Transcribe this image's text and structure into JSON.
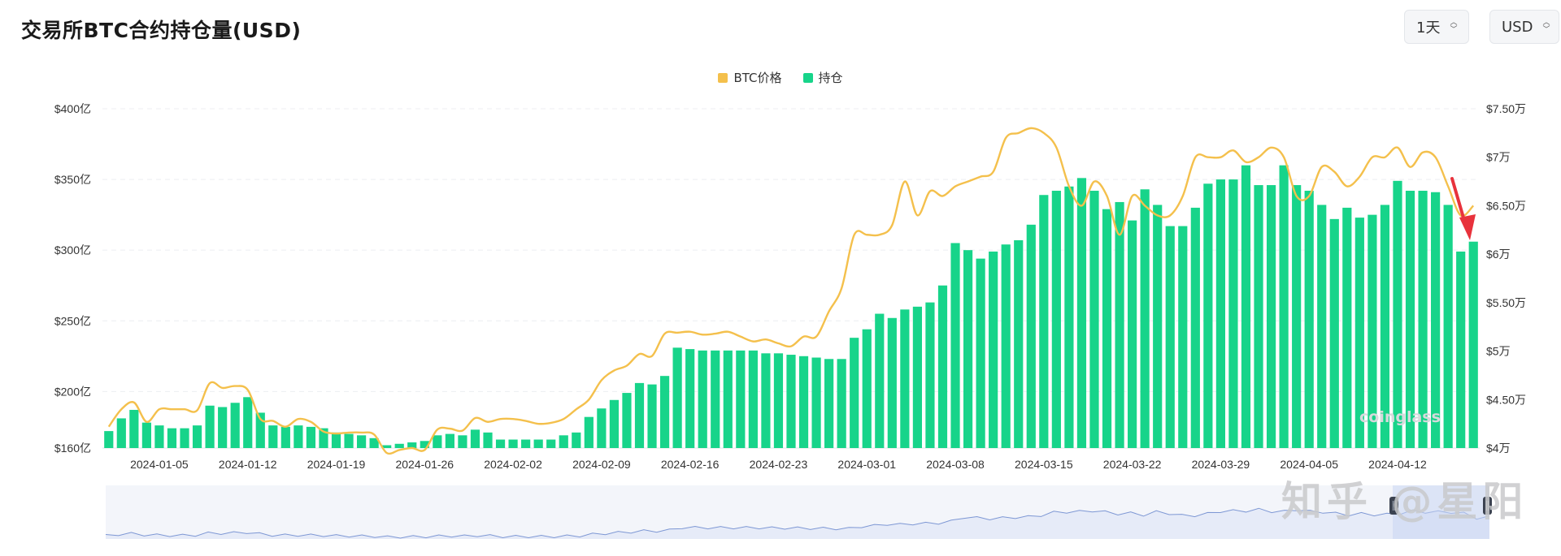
{
  "header": {
    "title": "交易所BTC合约持仓量(USD)",
    "range_select": "1天",
    "currency_select": "USD"
  },
  "legend": {
    "price_label": "BTC价格",
    "oi_label": "持仓",
    "price_color": "#f4c04c",
    "oi_color": "#17d48a"
  },
  "watermark": {
    "brand": "coinglass",
    "zhihu": "知乎 @星阳"
  },
  "chart_data": {
    "type": "bar",
    "title": "交易所BTC合约持仓量(USD)",
    "x_tick_labels": [
      "2024-01-05",
      "2024-01-12",
      "2024-01-19",
      "2024-01-26",
      "2024-02-02",
      "2024-02-09",
      "2024-02-16",
      "2024-02-23",
      "2024-03-01",
      "2024-03-08",
      "2024-03-15",
      "2024-03-22",
      "2024-03-29",
      "2024-04-05",
      "2024-04-12"
    ],
    "y_left": {
      "ticks": [
        "$400亿",
        "$350亿",
        "$300亿",
        "$250亿",
        "$200亿",
        "$160亿"
      ],
      "tick_values": [
        400,
        350,
        300,
        250,
        200,
        160
      ],
      "range": [
        160,
        400
      ]
    },
    "y_right": {
      "ticks": [
        "$7.50万",
        "$7万",
        "$6.50万",
        "$6万",
        "$5.50万",
        "$5万",
        "$4.50万",
        "$4万"
      ],
      "tick_values": [
        7.5,
        7,
        6.5,
        6,
        5.5,
        5,
        4.5,
        4
      ],
      "range": [
        4,
        7.5
      ]
    },
    "grid": true,
    "legend_position": "top-center",
    "start_date": "2024-01-01",
    "series": [
      {
        "name": "持仓",
        "kind": "bar",
        "axis": "left",
        "unit": "亿 USD",
        "values": [
          172,
          181,
          187,
          178,
          176,
          174,
          174,
          176,
          190,
          189,
          192,
          196,
          185,
          176,
          175,
          176,
          175,
          174,
          171,
          170,
          169,
          167,
          162,
          163,
          164,
          165,
          169,
          170,
          169,
          173,
          171,
          166,
          166,
          166,
          166,
          166,
          169,
          171,
          182,
          188,
          194,
          199,
          206,
          205,
          211,
          231,
          230,
          229,
          229,
          229,
          229,
          229,
          227,
          227,
          226,
          225,
          224,
          223,
          223,
          238,
          244,
          255,
          252,
          258,
          260,
          263,
          275,
          305,
          300,
          294,
          299,
          304,
          307,
          318,
          339,
          342,
          345,
          351,
          342,
          329,
          334,
          321,
          343,
          332,
          317,
          317,
          330,
          347,
          350,
          350,
          360,
          346,
          346,
          360,
          346,
          342,
          332,
          322,
          330,
          323,
          325,
          332,
          349,
          342,
          342,
          341,
          332,
          299,
          306
        ]
      },
      {
        "name": "BTC价格",
        "kind": "line",
        "axis": "right",
        "unit": "万 USD",
        "values": [
          4.22,
          4.4,
          4.47,
          4.27,
          4.4,
          4.4,
          4.4,
          4.39,
          4.67,
          4.62,
          4.64,
          4.6,
          4.3,
          4.28,
          4.22,
          4.3,
          4.27,
          4.17,
          4.15,
          4.16,
          4.16,
          4.14,
          3.95,
          3.98,
          4.0,
          3.98,
          4.19,
          4.2,
          4.18,
          4.31,
          4.27,
          4.3,
          4.3,
          4.28,
          4.25,
          4.26,
          4.3,
          4.4,
          4.5,
          4.7,
          4.8,
          4.85,
          4.97,
          4.95,
          5.18,
          5.19,
          5.2,
          5.17,
          5.18,
          5.2,
          5.15,
          5.1,
          5.12,
          5.08,
          5.05,
          5.15,
          5.15,
          5.41,
          5.65,
          6.2,
          6.2,
          6.2,
          6.3,
          6.75,
          6.4,
          6.65,
          6.6,
          6.7,
          6.75,
          6.8,
          6.85,
          7.2,
          7.25,
          7.3,
          7.25,
          7.1,
          6.7,
          6.5,
          6.75,
          6.6,
          6.2,
          6.6,
          6.5,
          6.4,
          6.4,
          6.6,
          7.0,
          7.0,
          7.0,
          7.07,
          6.95,
          7.0,
          7.1,
          7.0,
          6.6,
          6.6,
          6.9,
          6.85,
          6.7,
          6.8,
          7.0,
          7.0,
          7.1,
          6.9,
          7.05,
          7.0,
          6.7,
          6.4,
          6.5
        ]
      }
    ]
  }
}
